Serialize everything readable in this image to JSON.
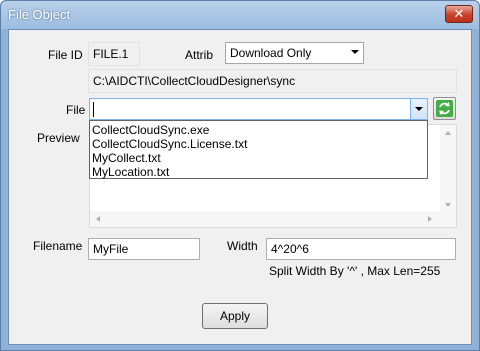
{
  "window": {
    "title": "File Object",
    "close_glyph": "✕"
  },
  "form": {
    "file_id_label": "File ID",
    "file_id_value": "FILE.1",
    "attrib_label": "Attrib",
    "attrib_value": "Download Only",
    "path_value": "C:\\AIDCTI\\CollectCloudDesigner\\sync",
    "file_label": "File",
    "file_value": "",
    "preview_label": "Preview",
    "file_options": [
      "CollectCloudSync.exe",
      "CollectCloudSync.License.txt",
      "MyCollect.txt",
      "MyLocation.txt"
    ],
    "filename_label": "Filename",
    "filename_value": "MyFile",
    "width_label": "Width",
    "width_value": "4^20^6",
    "width_hint": "Split Width By '^' , Max Len=255",
    "apply_label": "Apply"
  },
  "icons": {
    "refresh": "refresh-icon",
    "close": "close-icon",
    "dropdown": "chevron-down-icon"
  },
  "colors": {
    "close_button": "#c7412b",
    "refresh_green": "#2e9a35",
    "focus_border": "#7eb4ea"
  }
}
